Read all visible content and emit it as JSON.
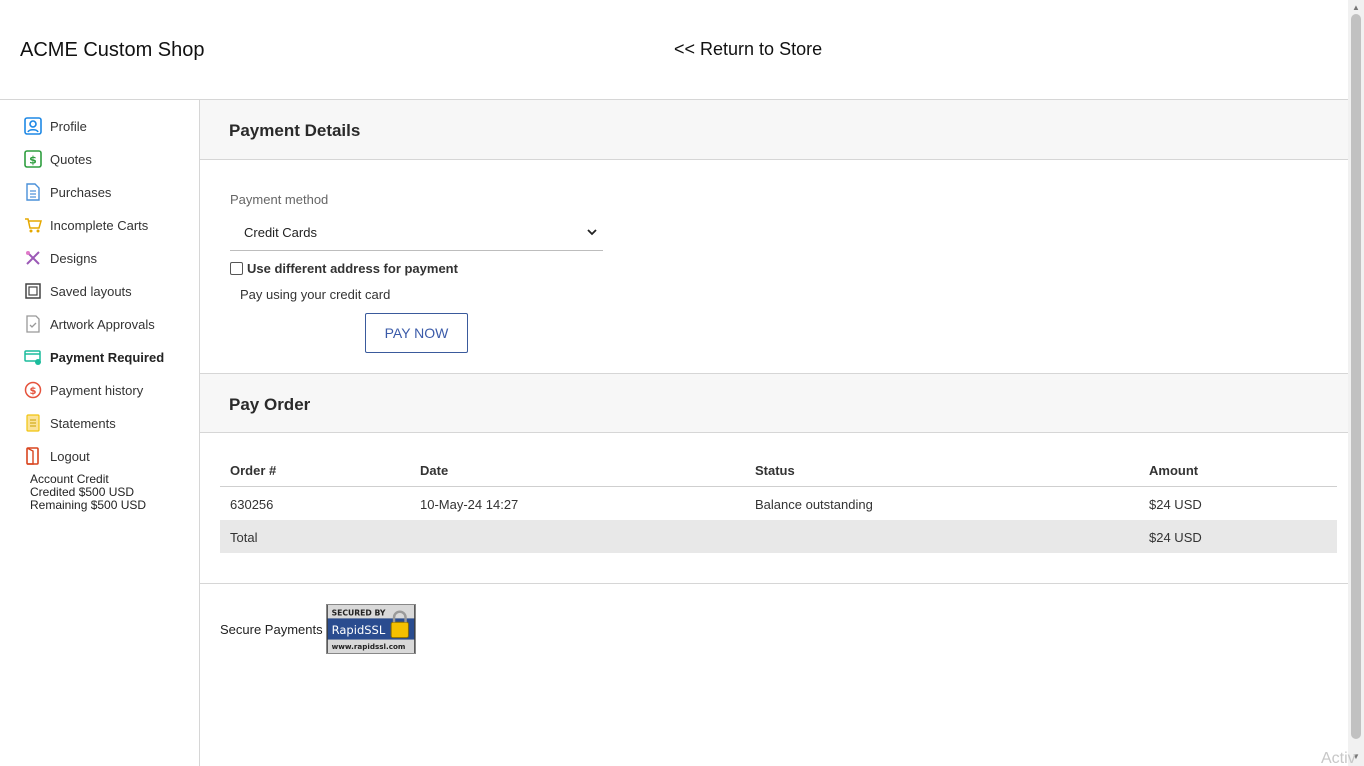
{
  "header": {
    "brand": "ACME Custom Shop",
    "return_link": "<< Return to Store"
  },
  "sidebar": {
    "items": [
      {
        "label": "Profile",
        "icon": "profile-icon",
        "color": "#1e88e5"
      },
      {
        "label": "Quotes",
        "icon": "dollar-icon",
        "color": "#2e9e3f"
      },
      {
        "label": "Purchases",
        "icon": "document-icon",
        "color": "#4a90d9"
      },
      {
        "label": "Incomplete Carts",
        "icon": "cart-icon",
        "color": "#e5a800"
      },
      {
        "label": "Designs",
        "icon": "design-icon",
        "color": "#9b59b6"
      },
      {
        "label": "Saved layouts",
        "icon": "layout-icon",
        "color": "#444444"
      },
      {
        "label": "Artwork Approvals",
        "icon": "approval-icon",
        "color": "#888888"
      },
      {
        "label": "Payment Required",
        "icon": "payment-icon",
        "color": "#1abc9c"
      },
      {
        "label": "Payment history",
        "icon": "history-icon",
        "color": "#e5533d"
      },
      {
        "label": "Statements",
        "icon": "statement-icon",
        "color": "#f1c40f"
      },
      {
        "label": "Logout",
        "icon": "logout-icon",
        "color": "#d9451f"
      }
    ],
    "active_label": "Payment Required",
    "credit": {
      "title": "Account Credit",
      "credited": "Credited $500 USD",
      "remaining": "Remaining $500 USD"
    }
  },
  "payment_details": {
    "title": "Payment Details",
    "method_label": "Payment method",
    "method_value": "Credit Cards",
    "different_address_label": "Use different address for payment",
    "different_address_checked": false,
    "note": "Pay using your credit card",
    "pay_button": "PAY NOW"
  },
  "pay_order": {
    "title": "Pay Order",
    "columns": [
      "Order #",
      "Date",
      "Status",
      "Amount"
    ],
    "rows": [
      [
        "630256",
        "10-May-24 14:27",
        "Balance outstanding",
        "$24 USD"
      ]
    ],
    "total_label": "Total",
    "total_amount": "$24 USD"
  },
  "footer": {
    "secure_text": "Secure Payments",
    "ssl_badge": {
      "line1": "SECURED BY",
      "line2": "RapidSSL",
      "line3": "www.rapidssl.com"
    }
  },
  "watermark": "Activ"
}
